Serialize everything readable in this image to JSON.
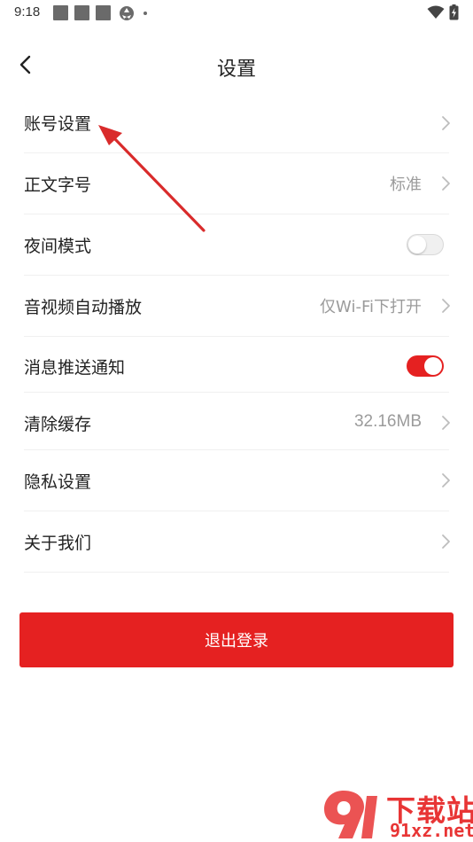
{
  "status_bar": {
    "time": "9:18",
    "icons": [
      "notification-square-icon",
      "notification-square-icon",
      "notification-square-icon",
      "aperture-icon",
      "dot-icon",
      "wifi-icon",
      "battery-charging-icon"
    ]
  },
  "header": {
    "back_icon": "chevron-left-icon",
    "title": "设置"
  },
  "settings": {
    "items": [
      {
        "label": "账号设置",
        "value": "",
        "control": "chevron"
      },
      {
        "label": "正文字号",
        "value": "标准",
        "control": "chevron"
      },
      {
        "label": "夜间模式",
        "value": "",
        "control": "toggle",
        "enabled": false
      },
      {
        "label": "音视频自动播放",
        "value": "仅Wi-Fi下打开",
        "control": "chevron"
      },
      {
        "label": "消息推送通知",
        "value": "",
        "control": "toggle",
        "enabled": true
      },
      {
        "label": "清除缓存",
        "value": "32.16MB",
        "control": "chevron"
      },
      {
        "label": "隐私设置",
        "value": "",
        "control": "chevron"
      },
      {
        "label": "关于我们",
        "value": "",
        "control": "chevron"
      }
    ]
  },
  "logout": {
    "label": "退出登录"
  },
  "annotation": {
    "icon": "red-arrow-icon"
  },
  "watermark": {
    "text_cn": "下载站",
    "text_en": "91xz.net"
  },
  "colors": {
    "accent": "#e52121",
    "toggle_on": "#e52121",
    "toggle_off": "#f0f0f0",
    "muted_text": "#9b9b9b",
    "divider": "#f0f0f0",
    "watermark": "#e83535"
  }
}
